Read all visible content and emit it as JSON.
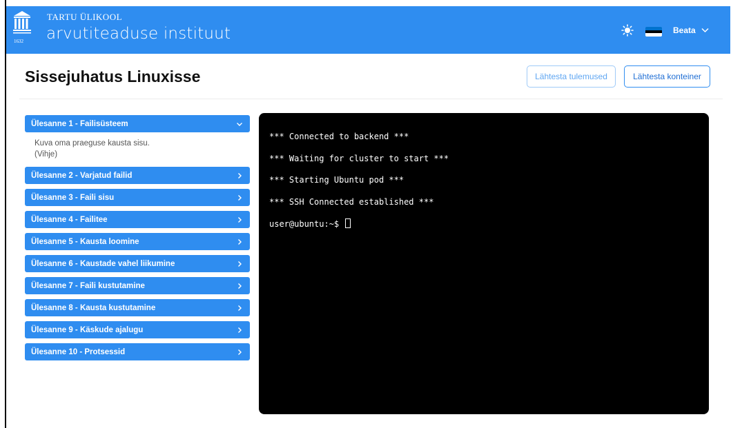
{
  "header": {
    "university": "TARTU ÜLIKOOL",
    "institute": "arvutiteaduse instituut",
    "logo_year": "1632",
    "theme_icon": "sun-icon",
    "language_flag": "estonian-flag-icon",
    "user_name": "Beata",
    "colors": {
      "header_bg": "#2f8df0",
      "flag_top": "#0072ce",
      "flag_mid": "#000000",
      "flag_bottom": "#ffffff"
    }
  },
  "page": {
    "title": "Sissejuhatus Linuxisse",
    "reset_results_label": "Lähtesta tulemused",
    "reset_container_label": "Lähtesta konteiner"
  },
  "tasks": [
    {
      "label": "Ülesanne 1 - Failisüsteem",
      "expanded": true,
      "description": "Kuva oma praeguse kausta sisu.",
      "hint": "(Vihje)"
    },
    {
      "label": "Ülesanne 2 - Varjatud failid",
      "expanded": false
    },
    {
      "label": "Ülesanne 3 - Faili sisu",
      "expanded": false
    },
    {
      "label": "Ülesanne 4 - Failitee",
      "expanded": false
    },
    {
      "label": "Ülesanne 5 - Kausta loomine",
      "expanded": false
    },
    {
      "label": "Ülesanne 6 - Kaustade vahel liikumine",
      "expanded": false
    },
    {
      "label": "Ülesanne 7 - Faili kustutamine",
      "expanded": false
    },
    {
      "label": "Ülesanne 8 - Kausta kustutamine",
      "expanded": false
    },
    {
      "label": "Ülesanne 9 - Käskude ajalugu",
      "expanded": false
    },
    {
      "label": "Ülesanne 10 - Protsessid",
      "expanded": false
    }
  ],
  "terminal": {
    "lines": [
      "*** Connected to backend ***",
      "*** Waiting for cluster to start ***",
      "*** Starting Ubuntu pod ***",
      "*** SSH Connected established ***"
    ],
    "prompt": "user@ubuntu:~$"
  }
}
